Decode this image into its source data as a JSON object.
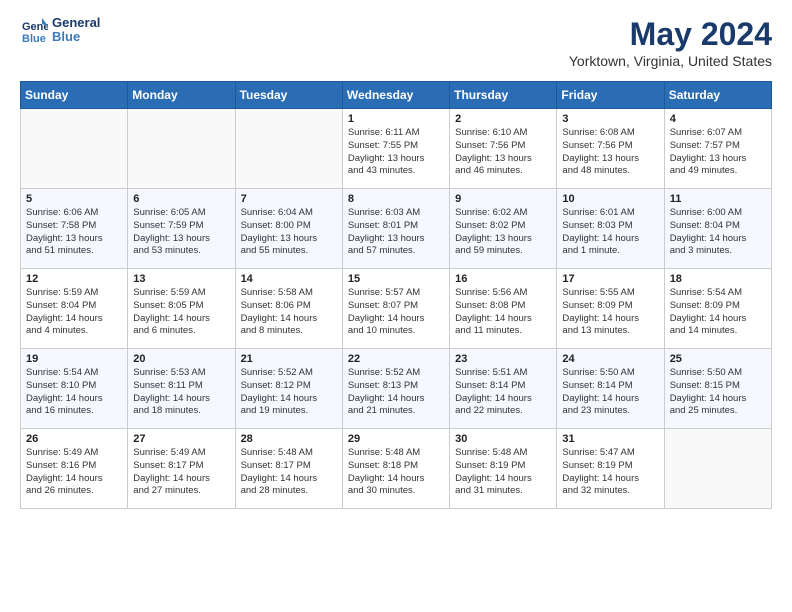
{
  "logo": {
    "line1": "General",
    "line2": "Blue"
  },
  "header": {
    "month": "May 2024",
    "location": "Yorktown, Virginia, United States"
  },
  "weekdays": [
    "Sunday",
    "Monday",
    "Tuesday",
    "Wednesday",
    "Thursday",
    "Friday",
    "Saturday"
  ],
  "weeks": [
    [
      {
        "day": "",
        "info": ""
      },
      {
        "day": "",
        "info": ""
      },
      {
        "day": "",
        "info": ""
      },
      {
        "day": "1",
        "info": "Sunrise: 6:11 AM\nSunset: 7:55 PM\nDaylight: 13 hours\nand 43 minutes."
      },
      {
        "day": "2",
        "info": "Sunrise: 6:10 AM\nSunset: 7:56 PM\nDaylight: 13 hours\nand 46 minutes."
      },
      {
        "day": "3",
        "info": "Sunrise: 6:08 AM\nSunset: 7:56 PM\nDaylight: 13 hours\nand 48 minutes."
      },
      {
        "day": "4",
        "info": "Sunrise: 6:07 AM\nSunset: 7:57 PM\nDaylight: 13 hours\nand 49 minutes."
      }
    ],
    [
      {
        "day": "5",
        "info": "Sunrise: 6:06 AM\nSunset: 7:58 PM\nDaylight: 13 hours\nand 51 minutes."
      },
      {
        "day": "6",
        "info": "Sunrise: 6:05 AM\nSunset: 7:59 PM\nDaylight: 13 hours\nand 53 minutes."
      },
      {
        "day": "7",
        "info": "Sunrise: 6:04 AM\nSunset: 8:00 PM\nDaylight: 13 hours\nand 55 minutes."
      },
      {
        "day": "8",
        "info": "Sunrise: 6:03 AM\nSunset: 8:01 PM\nDaylight: 13 hours\nand 57 minutes."
      },
      {
        "day": "9",
        "info": "Sunrise: 6:02 AM\nSunset: 8:02 PM\nDaylight: 13 hours\nand 59 minutes."
      },
      {
        "day": "10",
        "info": "Sunrise: 6:01 AM\nSunset: 8:03 PM\nDaylight: 14 hours\nand 1 minute."
      },
      {
        "day": "11",
        "info": "Sunrise: 6:00 AM\nSunset: 8:04 PM\nDaylight: 14 hours\nand 3 minutes."
      }
    ],
    [
      {
        "day": "12",
        "info": "Sunrise: 5:59 AM\nSunset: 8:04 PM\nDaylight: 14 hours\nand 4 minutes."
      },
      {
        "day": "13",
        "info": "Sunrise: 5:59 AM\nSunset: 8:05 PM\nDaylight: 14 hours\nand 6 minutes."
      },
      {
        "day": "14",
        "info": "Sunrise: 5:58 AM\nSunset: 8:06 PM\nDaylight: 14 hours\nand 8 minutes."
      },
      {
        "day": "15",
        "info": "Sunrise: 5:57 AM\nSunset: 8:07 PM\nDaylight: 14 hours\nand 10 minutes."
      },
      {
        "day": "16",
        "info": "Sunrise: 5:56 AM\nSunset: 8:08 PM\nDaylight: 14 hours\nand 11 minutes."
      },
      {
        "day": "17",
        "info": "Sunrise: 5:55 AM\nSunset: 8:09 PM\nDaylight: 14 hours\nand 13 minutes."
      },
      {
        "day": "18",
        "info": "Sunrise: 5:54 AM\nSunset: 8:09 PM\nDaylight: 14 hours\nand 14 minutes."
      }
    ],
    [
      {
        "day": "19",
        "info": "Sunrise: 5:54 AM\nSunset: 8:10 PM\nDaylight: 14 hours\nand 16 minutes."
      },
      {
        "day": "20",
        "info": "Sunrise: 5:53 AM\nSunset: 8:11 PM\nDaylight: 14 hours\nand 18 minutes."
      },
      {
        "day": "21",
        "info": "Sunrise: 5:52 AM\nSunset: 8:12 PM\nDaylight: 14 hours\nand 19 minutes."
      },
      {
        "day": "22",
        "info": "Sunrise: 5:52 AM\nSunset: 8:13 PM\nDaylight: 14 hours\nand 21 minutes."
      },
      {
        "day": "23",
        "info": "Sunrise: 5:51 AM\nSunset: 8:14 PM\nDaylight: 14 hours\nand 22 minutes."
      },
      {
        "day": "24",
        "info": "Sunrise: 5:50 AM\nSunset: 8:14 PM\nDaylight: 14 hours\nand 23 minutes."
      },
      {
        "day": "25",
        "info": "Sunrise: 5:50 AM\nSunset: 8:15 PM\nDaylight: 14 hours\nand 25 minutes."
      }
    ],
    [
      {
        "day": "26",
        "info": "Sunrise: 5:49 AM\nSunset: 8:16 PM\nDaylight: 14 hours\nand 26 minutes."
      },
      {
        "day": "27",
        "info": "Sunrise: 5:49 AM\nSunset: 8:17 PM\nDaylight: 14 hours\nand 27 minutes."
      },
      {
        "day": "28",
        "info": "Sunrise: 5:48 AM\nSunset: 8:17 PM\nDaylight: 14 hours\nand 28 minutes."
      },
      {
        "day": "29",
        "info": "Sunrise: 5:48 AM\nSunset: 8:18 PM\nDaylight: 14 hours\nand 30 minutes."
      },
      {
        "day": "30",
        "info": "Sunrise: 5:48 AM\nSunset: 8:19 PM\nDaylight: 14 hours\nand 31 minutes."
      },
      {
        "day": "31",
        "info": "Sunrise: 5:47 AM\nSunset: 8:19 PM\nDaylight: 14 hours\nand 32 minutes."
      },
      {
        "day": "",
        "info": ""
      }
    ]
  ]
}
